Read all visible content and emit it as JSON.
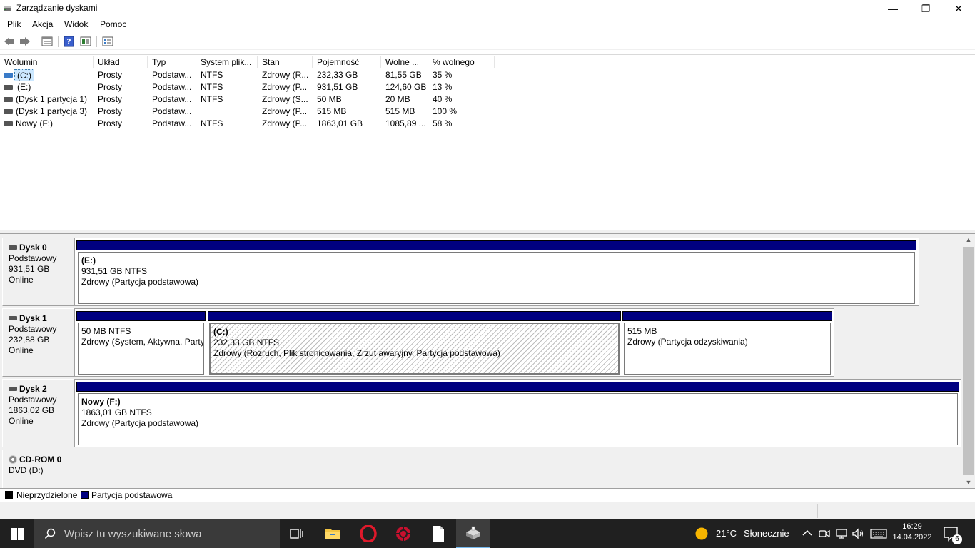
{
  "window": {
    "title": "Zarządzanie dyskami",
    "minimize": "—",
    "maximize": "❐",
    "close": "✕"
  },
  "menu": [
    "Plik",
    "Akcja",
    "Widok",
    "Pomoc"
  ],
  "toolbar": {
    "icons": [
      "back-arrow-icon",
      "forward-arrow-icon",
      "volume-list-icon",
      "help-icon",
      "graphical-view-icon",
      "properties-icon"
    ]
  },
  "volume_table": {
    "columns": [
      "Wolumin",
      "Układ",
      "Typ",
      "System plik...",
      "Stan",
      "Pojemność",
      "Wolne ...",
      "% wolnego"
    ],
    "rows": [
      {
        "volume": "(C:)",
        "layout": "Prosty",
        "type": "Podstaw...",
        "fs": "NTFS",
        "status": "Zdrowy (R...",
        "capacity": "232,33 GB",
        "free": "81,55 GB",
        "pct": "35 %",
        "selected": true
      },
      {
        "volume": "(E:)",
        "layout": "Prosty",
        "type": "Podstaw...",
        "fs": "NTFS",
        "status": "Zdrowy (P...",
        "capacity": "931,51 GB",
        "free": "124,60 GB",
        "pct": "13 %",
        "selected": false
      },
      {
        "volume": "(Dysk 1 partycja 1)",
        "layout": "Prosty",
        "type": "Podstaw...",
        "fs": "NTFS",
        "status": "Zdrowy (S...",
        "capacity": "50 MB",
        "free": "20 MB",
        "pct": "40 %",
        "selected": false
      },
      {
        "volume": "(Dysk 1 partycja 3)",
        "layout": "Prosty",
        "type": "Podstaw...",
        "fs": "",
        "status": "Zdrowy (P...",
        "capacity": "515 MB",
        "free": "515 MB",
        "pct": "100 %",
        "selected": false
      },
      {
        "volume": "Nowy (F:)",
        "layout": "Prosty",
        "type": "Podstaw...",
        "fs": "NTFS",
        "status": "Zdrowy (P...",
        "capacity": "1863,01 GB",
        "free": "1085,89 ...",
        "pct": "58 %",
        "selected": false
      }
    ]
  },
  "disks": [
    {
      "name": "Dysk 0",
      "kind": "Podstawowy",
      "size": "931,51 GB",
      "state": "Online",
      "partitions": [
        {
          "name": "(E:)",
          "size": "931,51 GB NTFS",
          "status": "Zdrowy (Partycja podstawowa)",
          "hatched": false
        }
      ]
    },
    {
      "name": "Dysk 1",
      "kind": "Podstawowy",
      "size": "232,88 GB",
      "state": "Online",
      "partitions": [
        {
          "name": "",
          "size": "50 MB NTFS",
          "status": "Zdrowy (System, Aktywna, Partycja podstawowa)",
          "hatched": false
        },
        {
          "name": "(C:)",
          "size": "232,33 GB NTFS",
          "status": "Zdrowy (Rozruch, Plik stronicowania, Zrzut awaryjny, Partycja podstawowa)",
          "hatched": true
        },
        {
          "name": "",
          "size": "515 MB",
          "status": "Zdrowy (Partycja odzyskiwania)",
          "hatched": false
        }
      ]
    },
    {
      "name": "Dysk 2",
      "kind": "Podstawowy",
      "size": "1863,02 GB",
      "state": "Online",
      "partitions": [
        {
          "name": "Nowy  (F:)",
          "size": "1863,01 GB NTFS",
          "status": "Zdrowy (Partycja podstawowa)",
          "hatched": false
        }
      ]
    },
    {
      "name": "CD-ROM 0",
      "kind": "DVD (D:)"
    }
  ],
  "legend": {
    "unallocated": "Nieprzydzielone",
    "primary": "Partycja podstawowa",
    "unallocated_color": "#000000",
    "primary_color": "#000080"
  },
  "taskbar": {
    "search_placeholder": "Wpisz tu wyszukiwane słowa",
    "apps": [
      "task-view-icon",
      "file-explorer-icon",
      "opera-icon",
      "red-app-icon",
      "document-icon",
      "disk-management-icon"
    ],
    "weather_temp": "21°C",
    "weather_text": "Słonecznie",
    "time": "16:29",
    "date": "14.04.2022",
    "notifications": "6"
  }
}
